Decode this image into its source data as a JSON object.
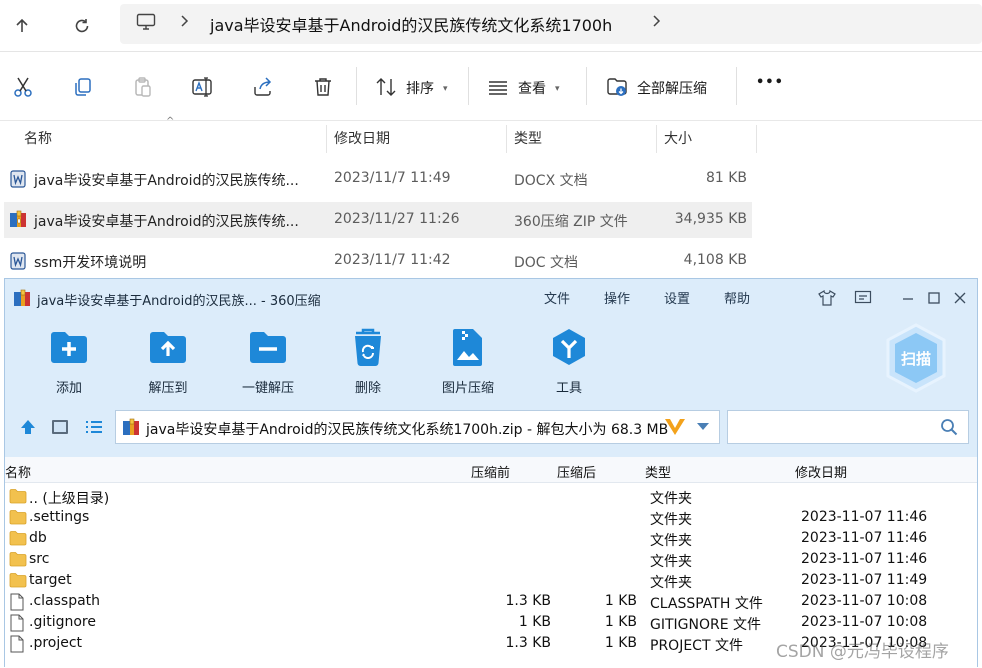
{
  "explorer": {
    "path": "java毕设安卓基于Android的汉民族传统文化系统1700h",
    "toolbar": {
      "sort_label": "排序",
      "view_label": "查看",
      "extract_all_label": "全部解压缩",
      "more_label": "•••"
    },
    "columns": {
      "name": "名称",
      "date": "修改日期",
      "type": "类型",
      "size": "大小"
    },
    "files": [
      {
        "name": "java毕设安卓基于Android的汉民族传统...",
        "date": "2023/11/7 11:49",
        "type": "DOCX 文档",
        "size": "81 KB",
        "icon": "word-doc-icon"
      },
      {
        "name": "java毕设安卓基于Android的汉民族传统...",
        "date": "2023/11/27 11:26",
        "type": "360压缩 ZIP 文件",
        "size": "34,935 KB",
        "icon": "zip-archive-icon"
      },
      {
        "name": "ssm开发环境说明",
        "date": "2023/11/7 11:42",
        "type": "DOC 文档",
        "size": "4,108 KB",
        "icon": "word-doc-icon"
      }
    ]
  },
  "zip": {
    "title": "java毕设安卓基于Android的汉民族... - 360压缩",
    "menu": [
      "文件",
      "操作",
      "设置",
      "帮助"
    ],
    "tools": [
      "添加",
      "解压到",
      "一键解压",
      "删除",
      "图片压缩",
      "工具"
    ],
    "scan_label": "扫描",
    "path": "java毕设安卓基于Android的汉民族传统文化系统1700h.zip - 解包大小为 68.3 MB",
    "columns": {
      "name": "名称",
      "before": "压缩前",
      "after": "压缩后",
      "type": "类型",
      "date": "修改日期"
    },
    "rows": [
      {
        "name": ".. (上级目录)",
        "before": "",
        "after": "",
        "type": "文件夹",
        "date": "",
        "kind": "folder"
      },
      {
        "name": ".settings",
        "before": "",
        "after": "",
        "type": "文件夹",
        "date": "2023-11-07 11:46",
        "kind": "folder"
      },
      {
        "name": "db",
        "before": "",
        "after": "",
        "type": "文件夹",
        "date": "2023-11-07 11:46",
        "kind": "folder"
      },
      {
        "name": "src",
        "before": "",
        "after": "",
        "type": "文件夹",
        "date": "2023-11-07 11:46",
        "kind": "folder"
      },
      {
        "name": "target",
        "before": "",
        "after": "",
        "type": "文件夹",
        "date": "2023-11-07 11:49",
        "kind": "folder"
      },
      {
        "name": ".classpath",
        "before": "1.3 KB",
        "after": "1 KB",
        "type": "CLASSPATH 文件",
        "date": "2023-11-07 10:08",
        "kind": "file"
      },
      {
        "name": ".gitignore",
        "before": "1 KB",
        "after": "1 KB",
        "type": "GITIGNORE 文件",
        "date": "2023-11-07 10:08",
        "kind": "file"
      },
      {
        "name": ".project",
        "before": "1.3 KB",
        "after": "1 KB",
        "type": "PROJECT 文件",
        "date": "2023-11-07 10:08",
        "kind": "file"
      }
    ]
  },
  "watermark": "CSDN @元冯毕设程序"
}
